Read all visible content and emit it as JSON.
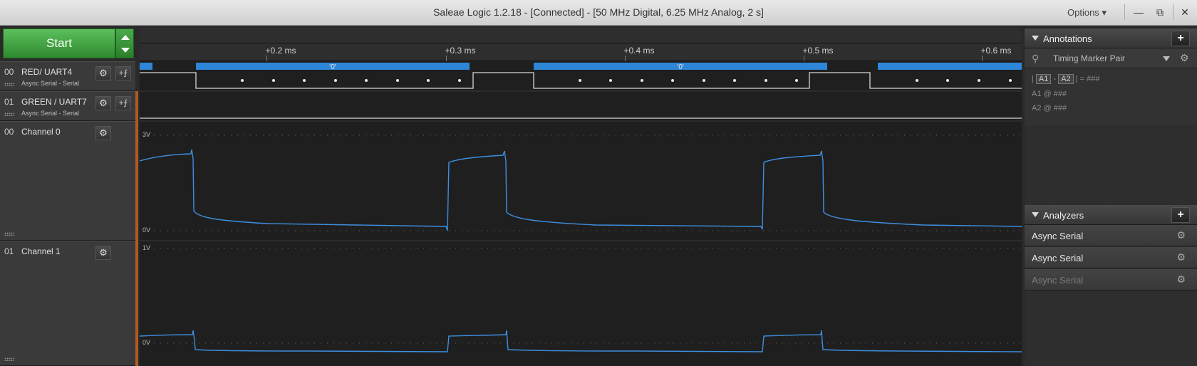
{
  "window": {
    "title": "Saleae Logic 1.2.18 - [Connected] - [50 MHz Digital, 6.25 MHz Analog, 2 s]",
    "options_label": "Options",
    "minimize": "—",
    "restore": "⧉",
    "close": "✕"
  },
  "toolbar": {
    "start_label": "Start"
  },
  "channels": [
    {
      "num": "00",
      "name": "RED/ UART4",
      "sub": "Async Serial - Serial"
    },
    {
      "num": "01",
      "name": "GREEN / UART7",
      "sub": "Async Serial - Serial"
    },
    {
      "num": "00",
      "name": "Channel 0"
    },
    {
      "num": "01",
      "name": "Channel 1"
    }
  ],
  "timeline": {
    "ticks": [
      "+0.2 ms",
      "+0.3 ms",
      "+0.4 ms",
      "+0.5 ms",
      "+0.6 ms"
    ]
  },
  "decoder": {
    "frames": [
      "'0'",
      "'0'"
    ]
  },
  "analog": {
    "ch0": {
      "top_label": "3V",
      "bottom_label": "0V"
    },
    "ch1": {
      "top_label": "1V",
      "bottom_label": "0V"
    }
  },
  "annotations": {
    "title": "Annotations",
    "marker_pair": "Timing Marker Pair",
    "line1_pre": "|",
    "line1_a1": "A1",
    "line1_dash": "-",
    "line1_a2": "A2",
    "line1_post": "| = ###",
    "line2": "A1  @  ###",
    "line3": "A2  @  ###"
  },
  "analyzers": {
    "title": "Analyzers",
    "items": [
      {
        "label": "Async Serial",
        "color": "#e8e8e8"
      },
      {
        "label": "Async Serial",
        "color": "#e8e8e8"
      },
      {
        "label": "Async Serial",
        "color": "#7a7a7a"
      }
    ]
  },
  "colors": {
    "analog_trace": "#3d8fe0",
    "decoder_bar": "#2d86d8",
    "digital_trace": "#d8d8d8",
    "channel_accent": "#b05a22"
  }
}
